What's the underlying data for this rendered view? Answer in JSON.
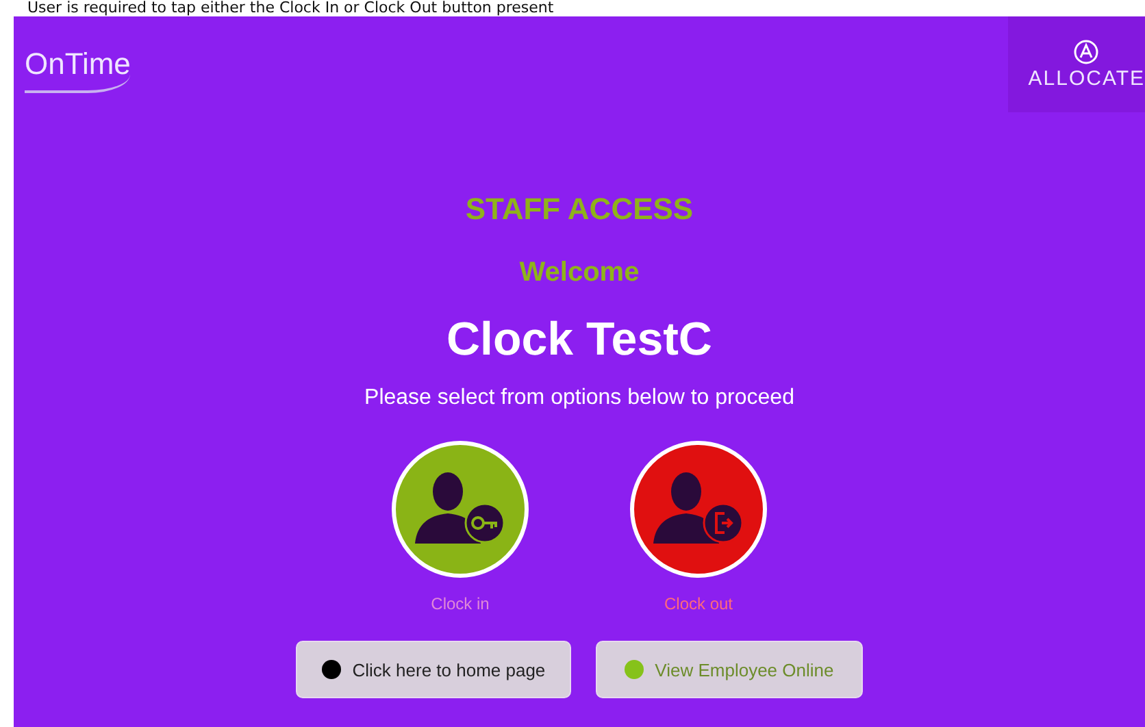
{
  "caption": "User is required to tap either the Clock In or Clock Out button present",
  "header": {
    "logo": "OnTime",
    "brand": "ALLOCATE"
  },
  "heading": "STAFF ACCESS",
  "greeting": "Welcome",
  "name": "Clock TestC",
  "instruction": "Please select from options below to proceed",
  "actions": [
    {
      "kind": "in",
      "label": "Clock in",
      "color": "#8ab416"
    },
    {
      "kind": "out",
      "label": "Clock out",
      "color": "#e01010"
    }
  ],
  "links": [
    {
      "label": "Click here to home page",
      "color": "#000000"
    },
    {
      "label": "View Employee Online",
      "color": "#86c21a"
    }
  ]
}
